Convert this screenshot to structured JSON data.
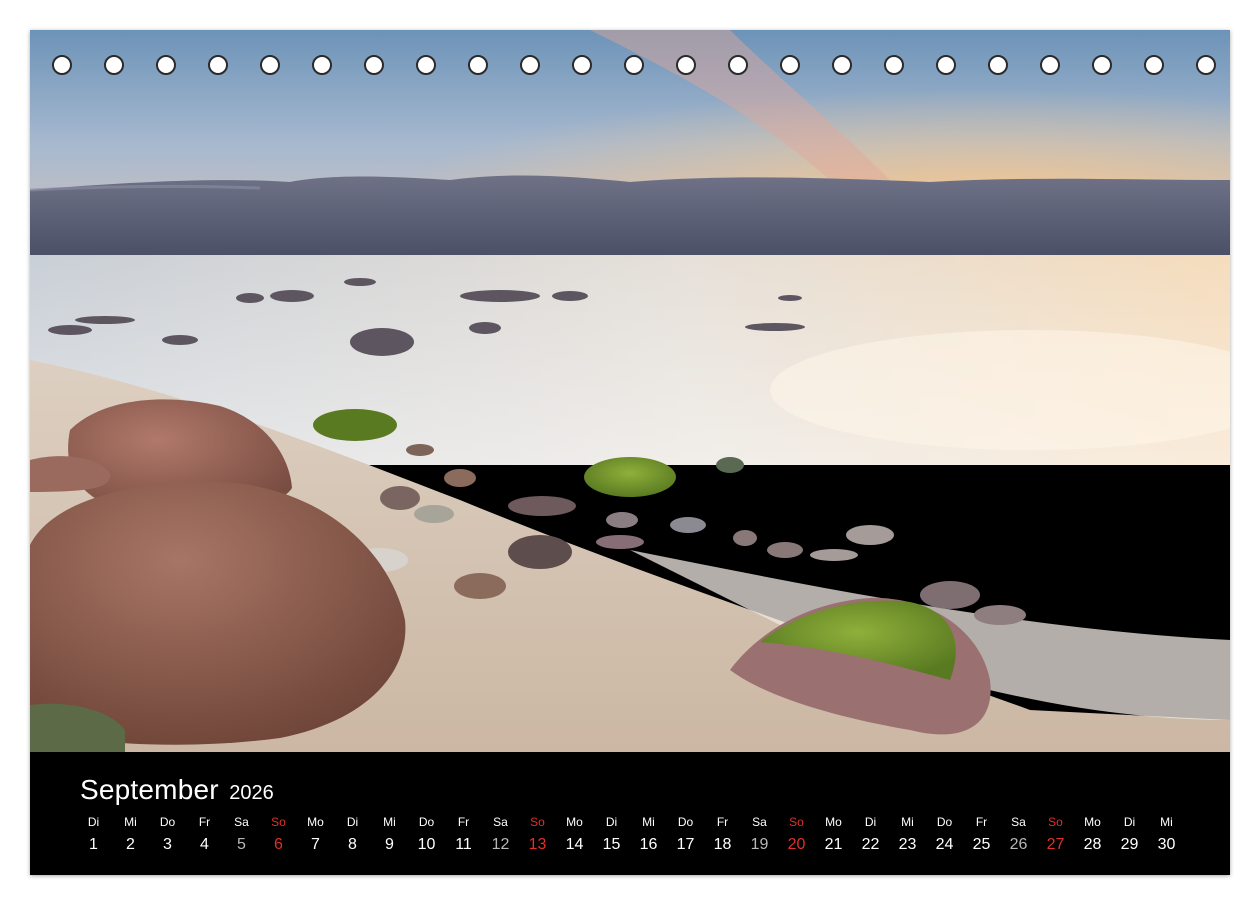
{
  "calendar": {
    "month": "September",
    "year": "2026",
    "weekdays": [
      "Di",
      "Mi",
      "Do",
      "Fr",
      "Sa",
      "So",
      "Mo",
      "Di",
      "Mi",
      "Do",
      "Fr",
      "Sa",
      "So",
      "Mo",
      "Di",
      "Mi",
      "Do",
      "Fr",
      "Sa",
      "So",
      "Mo",
      "Di",
      "Mi",
      "Do",
      "Fr",
      "Sa",
      "So",
      "Mo",
      "Di",
      "Mi"
    ],
    "dates": [
      "1",
      "2",
      "3",
      "4",
      "5",
      "6",
      "7",
      "8",
      "9",
      "10",
      "11",
      "12",
      "13",
      "14",
      "15",
      "16",
      "17",
      "18",
      "19",
      "20",
      "21",
      "22",
      "23",
      "24",
      "25",
      "26",
      "27",
      "28",
      "29",
      "30"
    ],
    "saturday_indices": [
      4,
      11,
      18,
      25
    ],
    "sunday_indices": [
      5,
      12,
      19,
      26
    ]
  },
  "binding_holes": 23,
  "colors": {
    "calendar_background": "#000000",
    "date_text": "#ffffff",
    "saturday_text": "#b8b8b8",
    "sunday_text": "#e0302a"
  }
}
